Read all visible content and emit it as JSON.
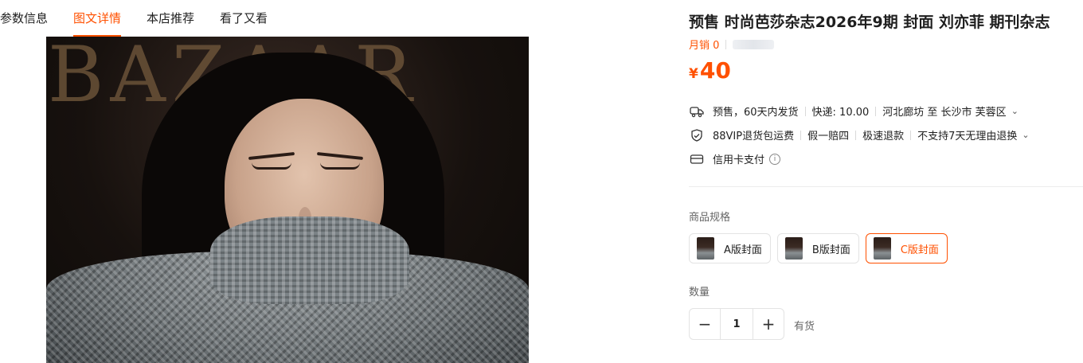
{
  "tabs": [
    "参数信息",
    "图文详情",
    "本店推荐",
    "看了又看"
  ],
  "active_tab_index": 1,
  "hero_image": {
    "masthead_text": "BAZAAR"
  },
  "product": {
    "title": "预售 时尚芭莎杂志2026年9期 封面 刘亦菲 期刊杂志",
    "monthly_sales": "月销 0",
    "price_currency": "¥",
    "price_value": "40",
    "shipping": {
      "presale": "预售，60天内发货",
      "express": "快递: 10.00",
      "route": "河北廊坊 至 长沙市 芙蓉区"
    },
    "guarantees": [
      "88VIP退货包运费",
      "假一赔四",
      "极速退款",
      "不支持7天无理由退换"
    ],
    "payment": "信用卡支付"
  },
  "specs": {
    "label": "商品规格",
    "options": [
      "A版封面",
      "B版封面",
      "C版封面"
    ],
    "selected_index": 2
  },
  "quantity": {
    "label": "数量",
    "value": "1",
    "minus": "−",
    "plus": "+",
    "stock": "有货"
  },
  "colors": {
    "accent": "#ff5000",
    "text": "#1f1f1f",
    "muted": "#666666"
  },
  "icons": [
    "truck-icon",
    "shield-return-icon",
    "credit-card-icon",
    "info-icon",
    "chevron-down-icon"
  ]
}
